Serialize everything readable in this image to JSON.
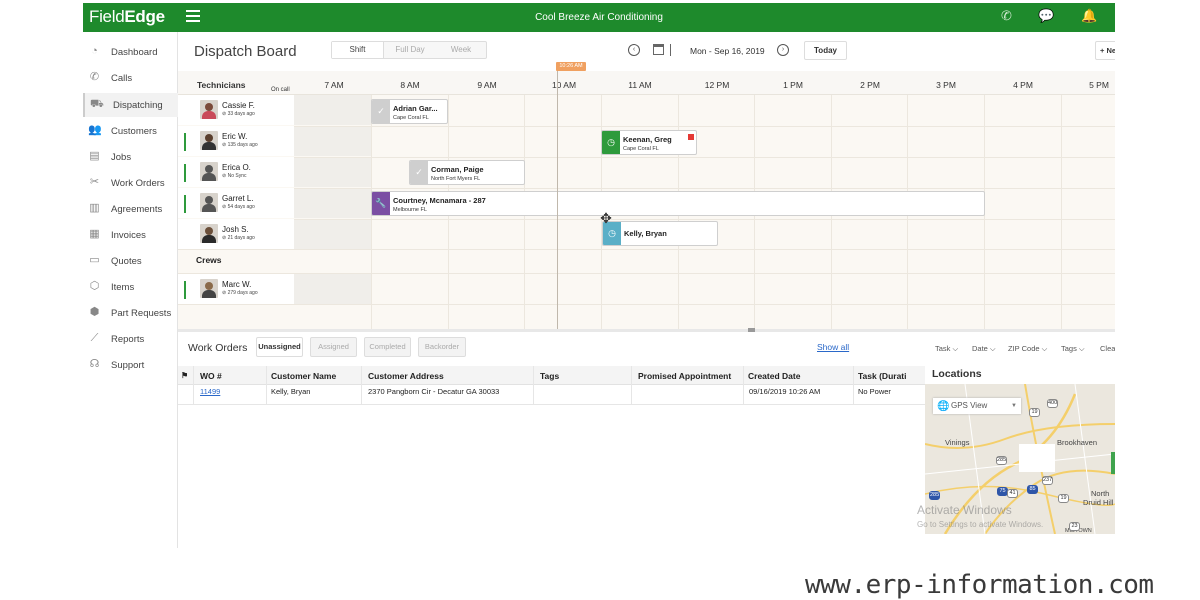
{
  "app": {
    "logo_light": "Field",
    "logo_bold": "Edge",
    "company": "Cool Breeze Air Conditioning"
  },
  "sidebar": {
    "items": [
      {
        "label": "Dashboard",
        "icon": "gauge-icon"
      },
      {
        "label": "Calls",
        "icon": "phone-icon"
      },
      {
        "label": "Dispatching",
        "icon": "truck-icon"
      },
      {
        "label": "Customers",
        "icon": "users-icon"
      },
      {
        "label": "Jobs",
        "icon": "clipboard-icon"
      },
      {
        "label": "Work Orders",
        "icon": "tools-icon"
      },
      {
        "label": "Agreements",
        "icon": "document-icon"
      },
      {
        "label": "Invoices",
        "icon": "invoice-icon"
      },
      {
        "label": "Quotes",
        "icon": "quote-icon"
      },
      {
        "label": "Items",
        "icon": "box-icon"
      },
      {
        "label": "Part Requests",
        "icon": "package-icon"
      },
      {
        "label": "Reports",
        "icon": "chart-icon"
      },
      {
        "label": "Support",
        "icon": "headset-icon"
      }
    ],
    "active": "Dispatching"
  },
  "board": {
    "title": "Dispatch Board",
    "views": [
      "Shift",
      "Full Day",
      "Week"
    ],
    "active_view": "Shift",
    "date": "Mon - Sep 16, 2019",
    "today": "Today",
    "new": "+ Ne",
    "now_time": "10:26 AM",
    "technicians_header": "Technicians",
    "on_call": "On call",
    "times": [
      "7 AM",
      "8 AM",
      "9 AM",
      "10 AM",
      "11 AM",
      "12 PM",
      "1 PM",
      "2 PM",
      "3 PM",
      "4 PM",
      "5 PM"
    ],
    "crews_label": "Crews",
    "technicians": [
      {
        "name": "Cassie F.",
        "sub": "⊘ 33 days ago"
      },
      {
        "name": "Eric W.",
        "sub": "⊘ 135 days ago"
      },
      {
        "name": "Erica O.",
        "sub": "⊘ No Sync"
      },
      {
        "name": "Garret L.",
        "sub": "⊘ 54 days ago"
      },
      {
        "name": "Josh S.",
        "sub": "⊘ 21 days ago"
      }
    ],
    "crews": [
      {
        "name": "Marc W.",
        "sub": "⊘ 279 days ago"
      }
    ],
    "jobs": [
      {
        "name": "Adrian Gar...",
        "location": "Cape Coral FL",
        "status": "done"
      },
      {
        "name": "Keenan, Greg",
        "location": "Cape Coral FL",
        "status": "in-progress"
      },
      {
        "name": "Corman, Paige",
        "location": "North Fort Myers FL",
        "status": "done"
      },
      {
        "name": "Courtney, Mcnamara - 287",
        "location": "Melbourne FL",
        "status": "working"
      },
      {
        "name": "Kelly, Bryan",
        "location": "",
        "status": "dragging"
      }
    ]
  },
  "work_orders": {
    "title": "Work Orders",
    "tabs": [
      "Unassigned",
      "Assigned",
      "Completed",
      "Backorder"
    ],
    "active_tab": "Unassigned",
    "show_all": "Show all",
    "filters": [
      "Task ⌵",
      "Date ⌵",
      "ZIP Code ⌵",
      "Tags ⌵",
      "Clea"
    ],
    "columns": [
      "WO #",
      "Customer Name",
      "Customer Address",
      "Tags",
      "Promised Appointment",
      "Created Date",
      "Task (Durati"
    ],
    "rows": [
      {
        "wo": "11499",
        "customer": "Kelly, Bryan",
        "address": "2370 Pangborn Cir - Decatur GA 30033",
        "tags": "",
        "promised": "",
        "created": "09/16/2019 10:26 AM",
        "task": "No Power"
      }
    ]
  },
  "locations": {
    "title": "Locations",
    "gps_view": "GPS View",
    "labels": [
      "Vinings",
      "Brookhaven",
      "North",
      "Druid Hill",
      "MIDTOWN"
    ],
    "shields": [
      "400",
      "19",
      "285",
      "75",
      "41",
      "237",
      "85",
      "19",
      "285",
      "23"
    ]
  },
  "watermark": {
    "main": "Activate Windows",
    "sub": "Go to Settings to activate Windows."
  },
  "site_url": "www.erp-information.com",
  "colors": {
    "brand_green": "#1e8a2c",
    "job_green": "#2e9a3c",
    "job_purple": "#7b4fa3",
    "job_teal": "#5aafc7",
    "link": "#2a68c9"
  }
}
